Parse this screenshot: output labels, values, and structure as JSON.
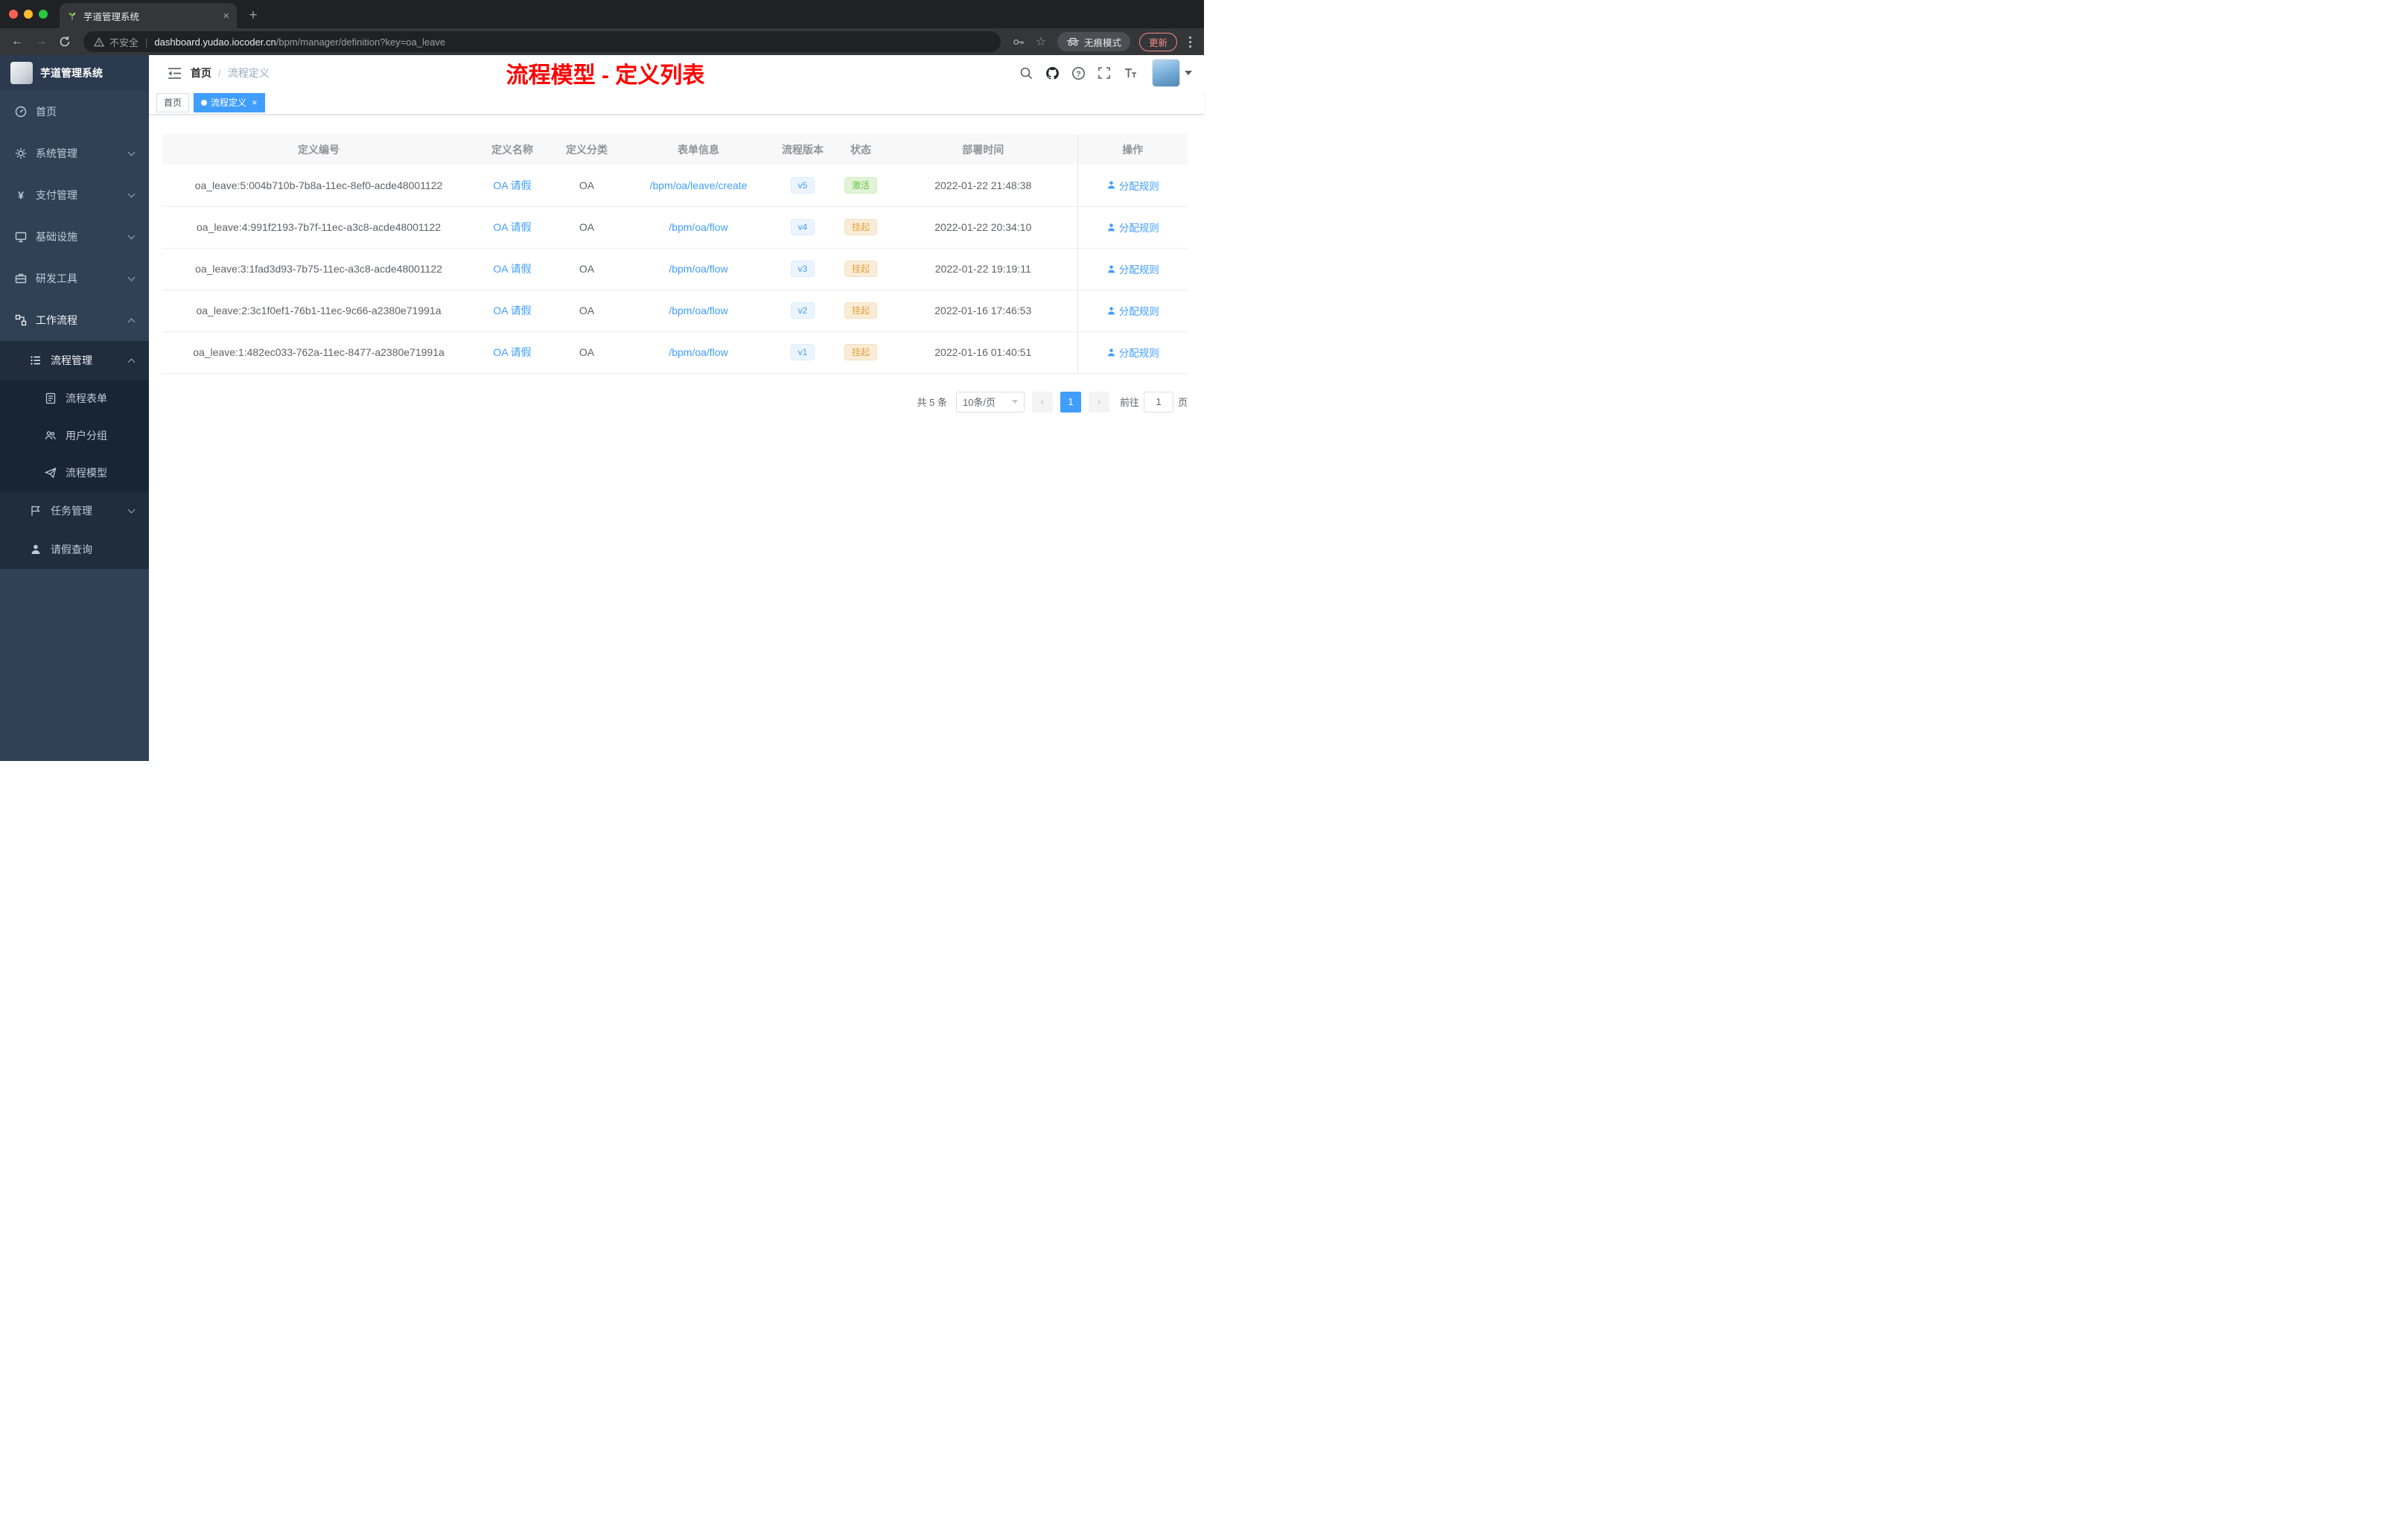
{
  "browser": {
    "tab_title": "芋道管理系统",
    "new_tab_glyph": "+",
    "tab_close_glyph": "×",
    "back_glyph": "←",
    "forward_glyph": "→",
    "security_label": "不安全",
    "url_host": "dashboard.yudao.iocoder.cn",
    "url_path": "/bpm/manager/definition?key=oa_leave",
    "star_glyph": "☆",
    "incognito_label": "无痕模式",
    "update_label": "更新"
  },
  "sidebar": {
    "app_title": "芋道管理系统",
    "menu": [
      {
        "label": "首页"
      },
      {
        "label": "系统管理"
      },
      {
        "label": "支付管理"
      },
      {
        "label": "基础设施"
      },
      {
        "label": "研发工具"
      },
      {
        "label": "工作流程"
      }
    ],
    "yen_glyph": "¥",
    "process_mgmt_label": "流程管理",
    "process_children": [
      {
        "label": "流程表单"
      },
      {
        "label": "用户分组"
      },
      {
        "label": "流程模型"
      }
    ],
    "task_mgmt_label": "任务管理",
    "leave_query_label": "请假查询"
  },
  "header": {
    "breadcrumb_home": "首页",
    "breadcrumb_sep": "/",
    "breadcrumb_current": "流程定义",
    "annotation": "流程模型 - 定义列表"
  },
  "tags": {
    "home_label": "首页",
    "current_label": "流程定义",
    "close_glyph": "×"
  },
  "table": {
    "columns": [
      "定义编号",
      "定义名称",
      "定义分类",
      "表单信息",
      "流程版本",
      "状态",
      "部署时间",
      "操作"
    ],
    "rows": [
      {
        "id": "oa_leave:5:004b710b-7b8a-11ec-8ef0-acde48001122",
        "name": "OA 请假",
        "category": "OA",
        "form": "/bpm/oa/leave/create",
        "version": "v5",
        "status": "激活",
        "status_class": "tag-success",
        "time": "2022-01-22 21:48:38",
        "action": "分配规则"
      },
      {
        "id": "oa_leave:4:991f2193-7b7f-11ec-a3c8-acde48001122",
        "name": "OA 请假",
        "category": "OA",
        "form": "/bpm/oa/flow",
        "version": "v4",
        "status": "挂起",
        "status_class": "tag-warning",
        "time": "2022-01-22 20:34:10",
        "action": "分配规则"
      },
      {
        "id": "oa_leave:3:1fad3d93-7b75-11ec-a3c8-acde48001122",
        "name": "OA 请假",
        "category": "OA",
        "form": "/bpm/oa/flow",
        "version": "v3",
        "status": "挂起",
        "status_class": "tag-warning",
        "time": "2022-01-22 19:19:11",
        "action": "分配规则"
      },
      {
        "id": "oa_leave:2:3c1f0ef1-76b1-11ec-9c66-a2380e71991a",
        "name": "OA 请假",
        "category": "OA",
        "form": "/bpm/oa/flow",
        "version": "v2",
        "status": "挂起",
        "status_class": "tag-warning",
        "time": "2022-01-16 17:46:53",
        "action": "分配规则"
      },
      {
        "id": "oa_leave:1:482ec033-762a-11ec-8477-a2380e71991a",
        "name": "OA 请假",
        "category": "OA",
        "form": "/bpm/oa/flow",
        "version": "v1",
        "status": "挂起",
        "status_class": "tag-warning",
        "time": "2022-01-16 01:40:51",
        "action": "分配规则"
      }
    ]
  },
  "pagination": {
    "total": "共 5 条",
    "page_size": "10条/页",
    "prev_glyph": "‹",
    "page": "1",
    "next_glyph": "›",
    "goto_label": "前往",
    "goto_value": "1",
    "unit_label": "页"
  },
  "colors": {
    "primary": "#409eff",
    "success": "#67c23a",
    "warning": "#e6a23c",
    "annotation_red": "#ff0000",
    "sidebar_bg": "#304156",
    "submenu_bg": "#1f2d3d"
  }
}
